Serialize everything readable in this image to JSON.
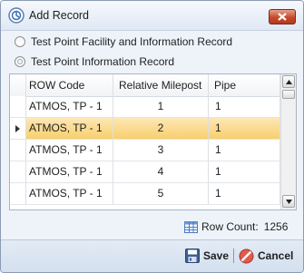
{
  "window": {
    "title": "Add Record",
    "close_icon": "close-icon"
  },
  "options": [
    {
      "label": "Test Point Facility and Information Record",
      "selected": false
    },
    {
      "label": "Test Point Information Record",
      "selected": true
    }
  ],
  "grid": {
    "columns": [
      "ROW Code",
      "Relative Milepost",
      "Pipe"
    ],
    "rows": [
      {
        "row_code": "ATMOS, TP - 1",
        "milepost": "1",
        "pipe": "1"
      },
      {
        "row_code": "ATMOS, TP - 1",
        "milepost": "2",
        "pipe": "1"
      },
      {
        "row_code": "ATMOS, TP - 1",
        "milepost": "3",
        "pipe": "1"
      },
      {
        "row_code": "ATMOS, TP - 1",
        "milepost": "4",
        "pipe": "1"
      },
      {
        "row_code": "ATMOS, TP - 1",
        "milepost": "5",
        "pipe": "1"
      }
    ],
    "selected_row": 1
  },
  "status": {
    "row_count_label": "Row Count:",
    "row_count_value": "1256"
  },
  "footer": {
    "save_label": "Save",
    "cancel_label": "Cancel"
  },
  "colors": {
    "selection": "#f8cf6b",
    "close_button": "#c64a2c"
  }
}
